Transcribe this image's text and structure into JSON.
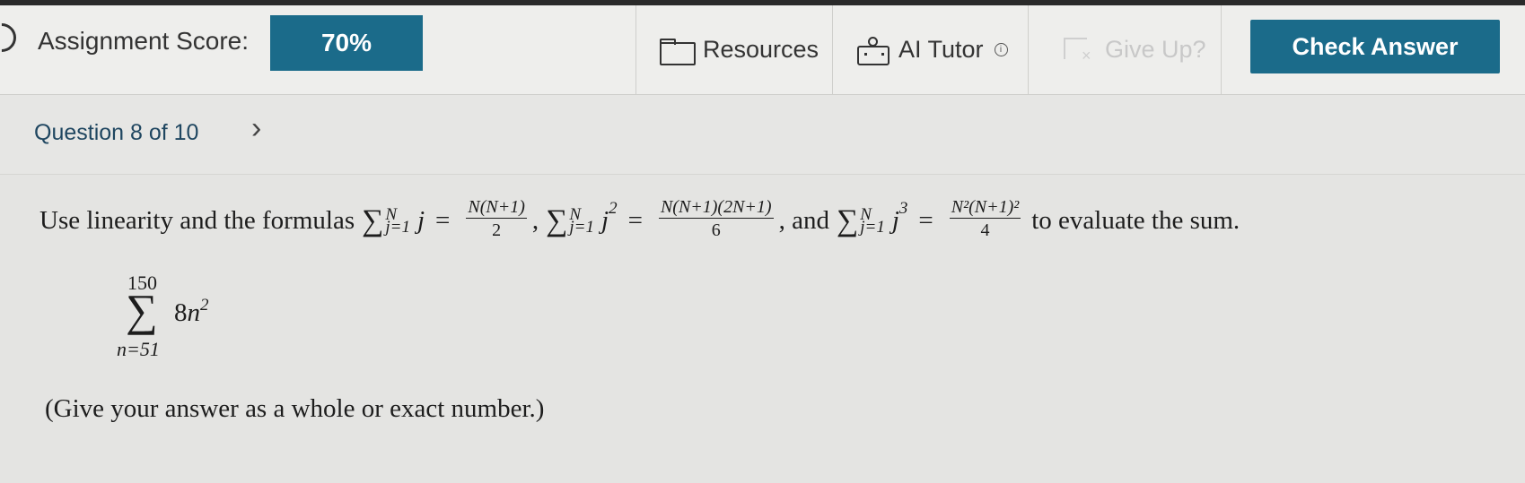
{
  "header": {
    "score_label": "Assignment Score:",
    "score_value": "70%",
    "resources_label": "Resources",
    "ai_tutor_label": "AI Tutor",
    "info_glyph": "i",
    "give_up_label": "Give Up?",
    "check_answer_label": "Check Answer",
    "accent_color": "#1b6b8a"
  },
  "question_nav": {
    "label": "Question 8 of 10",
    "next_glyph": "›"
  },
  "question": {
    "intro": "Use linearity and the formulas",
    "formula1": {
      "sigma": "∑",
      "upper": "N",
      "lower": "j=1",
      "term": "j",
      "eq": "=",
      "num": "N(N+1)",
      "den": "2",
      "sep": ","
    },
    "formula2": {
      "sigma": "∑",
      "upper": "N",
      "lower": "j=1",
      "term": "j",
      "exp": "2",
      "eq": "=",
      "num": "N(N+1)(2N+1)",
      "den": "6",
      "sep": ", and"
    },
    "formula3": {
      "sigma": "∑",
      "upper": "N",
      "lower": "j=1",
      "term": "j",
      "exp": "3",
      "eq": "=",
      "num": "N²(N+1)²",
      "den": "4"
    },
    "outro": "to evaluate the sum.",
    "sum": {
      "upper": "150",
      "sigma": "∑",
      "lower": "n=51",
      "coef": "8",
      "var": "n",
      "exp": "2"
    },
    "instruction": "(Give your answer as a whole or exact number.)"
  },
  "icons": {
    "resources": "folder-icon",
    "ai_tutor": "robot-icon",
    "give_up": "give-up-icon"
  }
}
